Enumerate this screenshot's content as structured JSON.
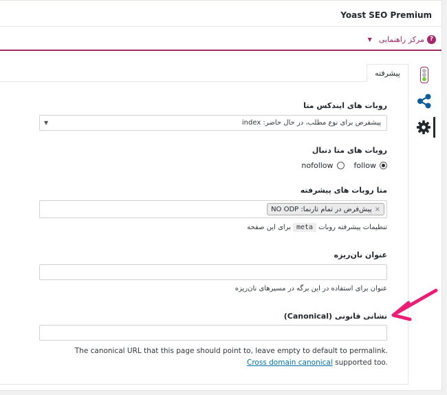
{
  "header": {
    "title": "Yoast SEO Premium"
  },
  "help": {
    "label": "مرکز راهنمایی",
    "icon_glyph": "?"
  },
  "tabs": [
    {
      "label": "پیشرفته"
    }
  ],
  "sidenav": [
    {
      "name": "traffic-light-icon"
    },
    {
      "name": "share-icon"
    },
    {
      "name": "gear-icon"
    }
  ],
  "fields": {
    "meta_robots_index": {
      "label": "روبات های ایندکس متا",
      "value": "پیشفرض برای نوع مطلب، در حال حاضر: index"
    },
    "meta_robots_follow": {
      "label": "روبات های متا دنبال",
      "options": [
        {
          "label": "follow",
          "checked": true
        },
        {
          "label": "nofollow",
          "checked": false
        }
      ]
    },
    "meta_robots_advanced": {
      "label": "متا روبات های پیشرفته",
      "tag": "پیش‌فرض در تمام تارنما: NO ODP",
      "tag_remove": "×",
      "desc_before": "تنظیمات پیشرفته روبات",
      "desc_code": "meta",
      "desc_after": "برای این صفحه"
    },
    "breadcrumb_title": {
      "label": "عنوان نان‌ریزه",
      "value": "",
      "desc": "عنوان برای استفاده در این برگه در مسیرهای نان‌ریزه"
    },
    "canonical": {
      "label": "نشانی قانونی (Canonical)",
      "value": "",
      "help_text": "The canonical URL that this page should point to, leave empty to default to permalink. ",
      "help_link": "Cross domain canonical",
      "help_after": " supported too."
    }
  },
  "colors": {
    "brand": "#a4286a",
    "annotation_arrow": "#e91e74",
    "link": "#0073aa"
  }
}
